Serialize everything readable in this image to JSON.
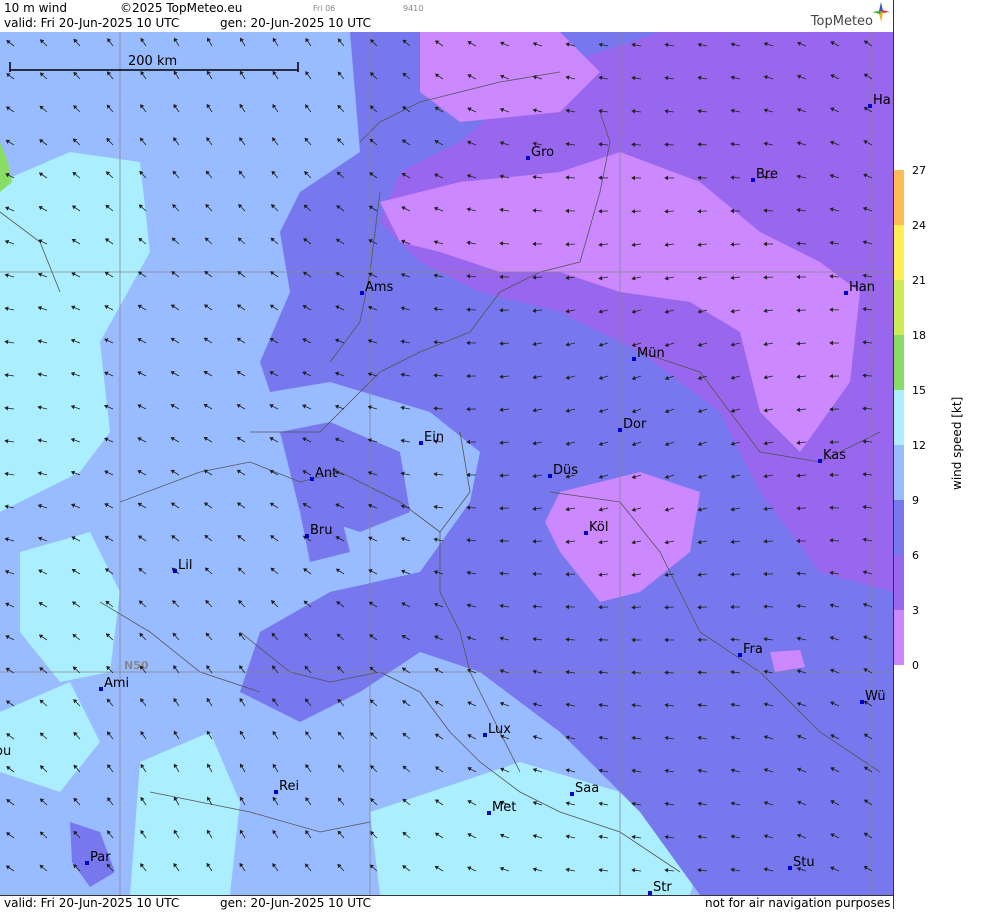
{
  "header": {
    "product": "10 m wind",
    "copyright": "©2025 TopMeteo.eu",
    "day_tiny": "Fri 06",
    "code_tiny": "9410",
    "valid": "valid:  Fri  20-Jun-2025  10 UTC",
    "gen": "gen: 20-Jun-2025 10 UTC",
    "logo": "TopMeteo"
  },
  "footer": {
    "valid": "valid:  Fri  20-Jun-2025  10 UTC",
    "gen": "gen: 20-Jun-2025 10 UTC",
    "note": "not for air navigation purposes"
  },
  "scale_bar": {
    "label": "200 km"
  },
  "lat_label": "N50",
  "legend": {
    "title": "wind  speed  [kt]",
    "ticks": [
      "0",
      "3",
      "6",
      "9",
      "12",
      "15",
      "18",
      "21",
      "24",
      "27"
    ],
    "colors": [
      "#cc88ff",
      "#9966ee",
      "#7777ee",
      "#99bbff",
      "#aaeeff",
      "#88dd66",
      "#ccee55",
      "#ffee55",
      "#ffbb55",
      "#ff7755"
    ]
  },
  "cities": [
    {
      "name": "Gro"
    },
    {
      "name": "Bre"
    },
    {
      "name": "Ha"
    },
    {
      "name": "Ams"
    },
    {
      "name": "Han"
    },
    {
      "name": "Mün"
    },
    {
      "name": "Ein"
    },
    {
      "name": "Dor"
    },
    {
      "name": "Ant"
    },
    {
      "name": "Düs"
    },
    {
      "name": "Kas"
    },
    {
      "name": "Bru"
    },
    {
      "name": "Köl"
    },
    {
      "name": "Lil"
    },
    {
      "name": "Fra"
    },
    {
      "name": "Ami"
    },
    {
      "name": "Wü"
    },
    {
      "name": "ou"
    },
    {
      "name": "Lux"
    },
    {
      "name": "Rei"
    },
    {
      "name": "Saa"
    },
    {
      "name": "Met"
    },
    {
      "name": "Par"
    },
    {
      "name": "Stu"
    },
    {
      "name": "Str"
    }
  ]
}
